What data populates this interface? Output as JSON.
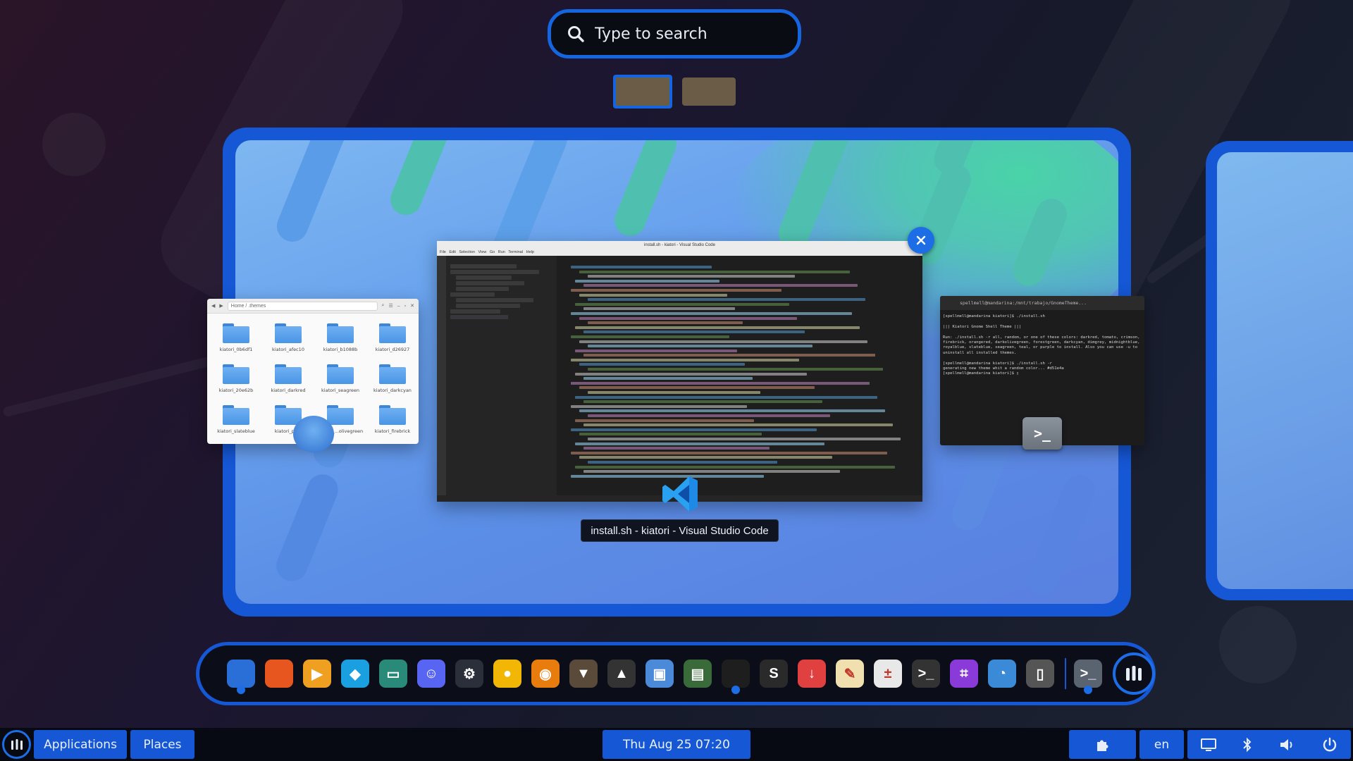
{
  "search": {
    "placeholder": "Type to search"
  },
  "workspaces": {
    "count": 2,
    "active_index": 1
  },
  "windows": {
    "files": {
      "path": [
        "Home",
        ".themes"
      ],
      "folders": [
        "kiatori_0b6df1",
        "kiatori_afec10",
        "kiatori_b1088b",
        "kiatori_d26927",
        "kiatori_20e62b",
        "kiatori_darkred",
        "kiatori_seagreen",
        "kiatori_darkcyan",
        "kiatori_slateblue",
        "kiatori_pu...",
        "kiatori_...olivegreen",
        "kiatori_firebrick"
      ]
    },
    "vscode": {
      "title": "install.sh - kiatori - Visual Studio Code",
      "menu": "File Edit Selection View Go Run Terminal Help",
      "caption": "install.sh - kiatori - Visual Studio Code"
    },
    "terminal": {
      "title": "spellmell@mandarina:/mnt/trabajo/GnomeTheme...",
      "output": "[spellmell@mandarina kiatori]$ ./install.sh\n\n||| Kiatori Gnome Shell Theme |||\n\nRun: ./install.sh -r all, random, or one of these colors: darkred, tomato, crimson, firebrick, orangered, darkolivegreen, forestgreen, darkcyan, dimgrey, midnightblue, royalblue, slateblue, seagreen, teal, or purple to install. Also you can use -u to uninstall all installed themes.\n\n[spellmell@mandarina kiatori]$ ./install.sh -r\ngenerating new theme whit a random color... #d51e4a\n[spellmell@mandarina kiatori]$ ▯"
    }
  },
  "dock": {
    "apps": [
      {
        "name": "files",
        "glyph": "",
        "bg": "#2a6fd8",
        "running": true
      },
      {
        "name": "firefox",
        "glyph": "",
        "bg": "#e8561f",
        "running": false
      },
      {
        "name": "media-player",
        "glyph": "▶",
        "bg": "#f0a020",
        "running": false
      },
      {
        "name": "kodi",
        "glyph": "◆",
        "bg": "#1aa0e0",
        "running": false
      },
      {
        "name": "virtualbox",
        "glyph": "▭",
        "bg": "#2a8a7a",
        "running": false
      },
      {
        "name": "discord",
        "glyph": "☺",
        "bg": "#5865f2",
        "running": false
      },
      {
        "name": "steam",
        "glyph": "⚙",
        "bg": "#2a2f3a",
        "running": false
      },
      {
        "name": "lutris",
        "glyph": "●",
        "bg": "#f2b705",
        "running": false
      },
      {
        "name": "blender",
        "glyph": "◉",
        "bg": "#e87d0d",
        "running": false
      },
      {
        "name": "gimp",
        "glyph": "▼",
        "bg": "#5a4a3a",
        "running": false
      },
      {
        "name": "inkscape",
        "glyph": "▲",
        "bg": "#333",
        "running": false
      },
      {
        "name": "image-viewer",
        "glyph": "▣",
        "bg": "#4a8ad8",
        "running": false
      },
      {
        "name": "system-monitor",
        "glyph": "▤",
        "bg": "#3a6a3a",
        "running": false
      },
      {
        "name": "vscode",
        "glyph": "",
        "bg": "#1e1e1e",
        "running": true
      },
      {
        "name": "sublime-text",
        "glyph": "S",
        "bg": "#2a2a2a",
        "running": false
      },
      {
        "name": "downloader",
        "glyph": "↓",
        "bg": "#e04040",
        "running": false
      },
      {
        "name": "text-editor",
        "glyph": "✎",
        "bg": "#f0e0b0",
        "running": false
      },
      {
        "name": "calculator",
        "glyph": "±",
        "bg": "#e8e8e8",
        "running": false
      },
      {
        "name": "guake",
        "glyph": ">_",
        "bg": "#333",
        "running": false
      },
      {
        "name": "screenshot",
        "glyph": "⌗",
        "bg": "#8a3ad8",
        "running": false
      },
      {
        "name": "disk-usage",
        "glyph": "◔",
        "bg": "#3a8ad8",
        "running": false
      },
      {
        "name": "usb-creator",
        "glyph": "▯",
        "bg": "#555",
        "running": false
      }
    ],
    "pinned_terminal": {
      "name": "terminal",
      "glyph": ">_",
      "bg": "#5a6470",
      "running": true
    }
  },
  "panel": {
    "applications_label": "Applications",
    "places_label": "Places",
    "clock": "Thu Aug 25  07:20",
    "language": "en"
  },
  "colors": {
    "accent": "#1557d4",
    "accent_light": "#1d6ee6"
  }
}
